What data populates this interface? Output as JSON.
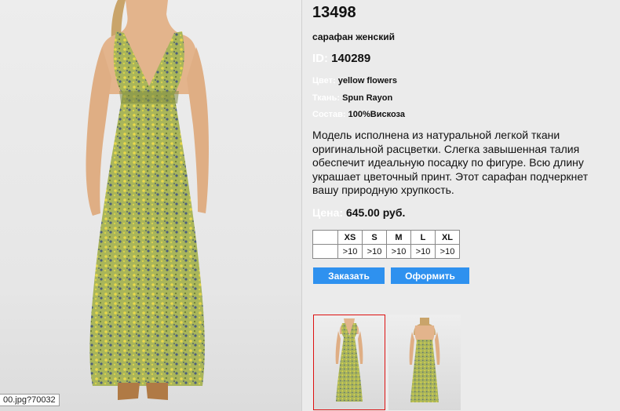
{
  "product": {
    "code": "13498",
    "name": "сарафан женский",
    "id_label": "ID:",
    "id_value": "140289",
    "attributes": [
      {
        "label": "Цвет:",
        "value": "yellow flowers"
      },
      {
        "label": "Ткань:",
        "value": "Spun Rayon"
      },
      {
        "label": "Состав:",
        "value": "100%Вискоза"
      }
    ],
    "description": "Модель исполнена из натуральной легкой ткани оригинальной расцветки. Слегка завышенная талия обеспечит идеальную посадку по фигуре. Всю длину украшает цветочный принт. Этот сарафан подчеркнет вашу природную хрупкость.",
    "price_label": "Цена:",
    "price_value": "645.00 руб."
  },
  "sizes": {
    "headers": [
      "XS",
      "S",
      "M",
      "L",
      "XL"
    ],
    "stock": [
      ">10",
      ">10",
      ">10",
      ">10",
      ">10"
    ]
  },
  "buttons": {
    "order": "Заказать",
    "checkout": "Оформить"
  },
  "url_tooltip": "00.jpg?70032",
  "colors": {
    "button": "#2e91ef",
    "selected_thumb_border": "#dd1111",
    "dress_green": "#a8b65c",
    "print_blue": "#4a5f7a"
  }
}
